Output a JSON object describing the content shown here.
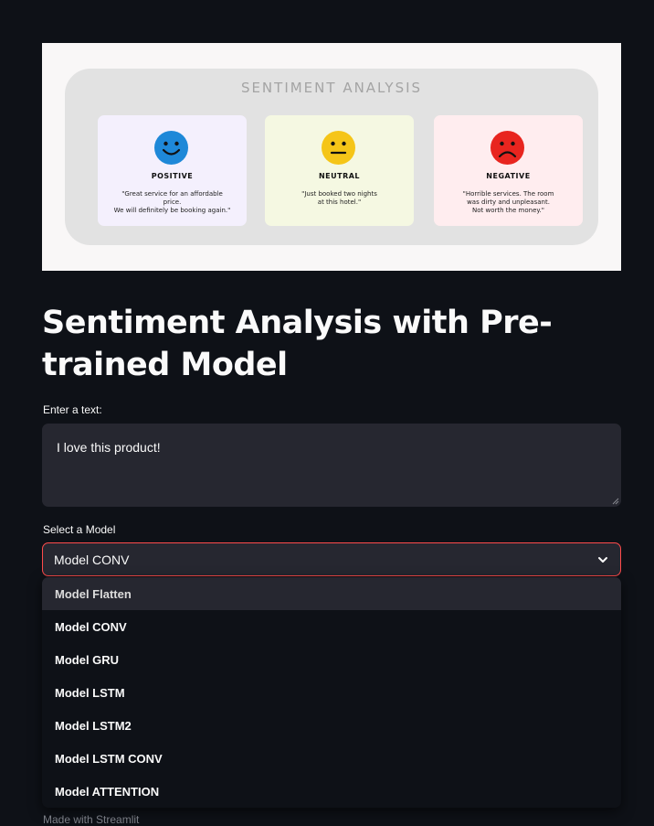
{
  "banner": {
    "title": "SENTIMENT ANALYSIS",
    "cards": [
      {
        "label": "POSITIVE",
        "quote": "\"Great service for an affordable\nprice.\nWe will definitely be booking again.\"",
        "color": "#1e88d8"
      },
      {
        "label": "NEUTRAL",
        "quote": "\"Just booked two nights\nat this hotel.\"",
        "color": "#f5c518"
      },
      {
        "label": "NEGATIVE",
        "quote": "\"Horrible services. The room\nwas dirty and unpleasant.\nNot worth the money.\"",
        "color": "#e8251f"
      }
    ]
  },
  "page": {
    "title": "Sentiment Analysis with Pre-trained Model"
  },
  "text_input": {
    "label": "Enter a text:",
    "value": "I love this product!"
  },
  "model_select": {
    "label": "Select a Model",
    "selected": "Model CONV",
    "options": [
      "Model Flatten",
      "Model CONV",
      "Model GRU",
      "Model LSTM",
      "Model LSTM2",
      "Model LSTM CONV",
      "Model ATTENTION"
    ],
    "highlighted_option": "Model Flatten",
    "accent_color": "#ff4b4b"
  },
  "footer": {
    "text": "Made with Streamlit"
  }
}
